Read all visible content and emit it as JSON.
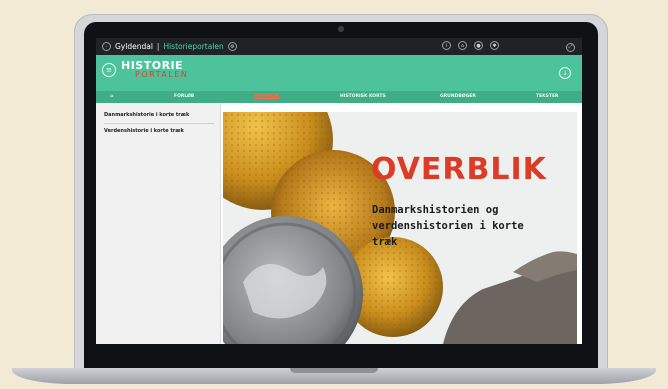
{
  "topbar": {
    "menu_icon": "globe-icon",
    "brand": "Gyldendal",
    "separator": "|",
    "portal": "Historieportalen",
    "icons": [
      "info-icon",
      "home-icon",
      "user-icon",
      "settings-icon"
    ],
    "right_icon": "expand-icon"
  },
  "header": {
    "logo_line1": "HISTORIE",
    "logo_line2": "PORTALEN",
    "right_icon": "download-icon",
    "colors": {
      "header": "#4cc39a",
      "nav": "#3fae87",
      "accent": "#dc3c26"
    }
  },
  "nav": {
    "items": [
      {
        "label": "FORLØB",
        "active": false
      },
      {
        "label": "OVERBLIK",
        "active": true
      },
      {
        "label": "HISTORISK KORTS",
        "active": false
      },
      {
        "label": "GRUNDBØGER",
        "active": false
      },
      {
        "label": "TEKSTER",
        "active": false
      }
    ]
  },
  "sidebar": {
    "items": [
      {
        "label": "Danmarkshistorie i korte træk"
      },
      {
        "label": "Verdenshistorie i korte træk"
      }
    ]
  },
  "content": {
    "title": "OVERBLIK",
    "subtitle": "Danmarkshistorien og verdenshistorien i korte træk"
  }
}
